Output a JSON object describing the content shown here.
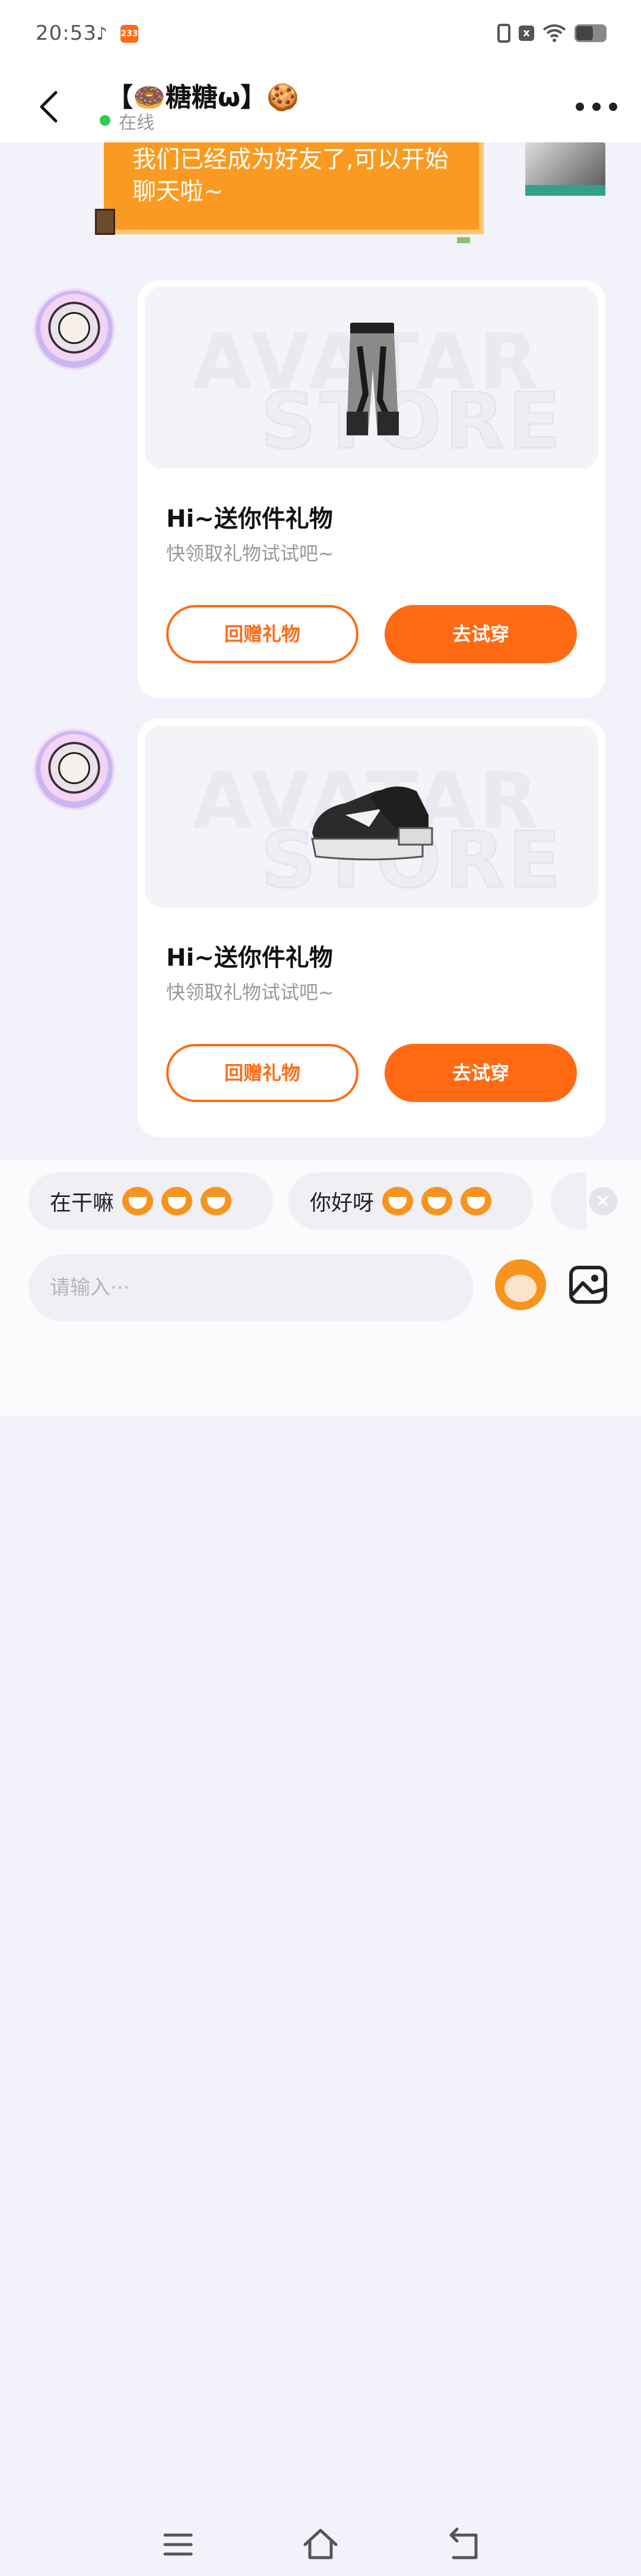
{
  "status_bar": {
    "time": "20:53",
    "badge": "233",
    "sim_icon_label": "x"
  },
  "header": {
    "title": "【🍩糖糖ω】🍪",
    "status": "在线"
  },
  "system_banner": {
    "text": "我们已经成为好友了,可以开始聊天啦~"
  },
  "messages": [
    {
      "watermark_line1": "AVATAR",
      "watermark_line2": "STORE",
      "item_icon": "pants-icon",
      "title": "Hi~送你件礼物",
      "subtitle": "快领取礼物试试吧~",
      "return_gift_label": "回赠礼物",
      "try_on_label": "去试穿"
    },
    {
      "watermark_line1": "AVATAR",
      "watermark_line2": "STORE",
      "item_icon": "sneakers-icon",
      "title": "Hi~送你件礼物",
      "subtitle": "快领取礼物试试吧~",
      "return_gift_label": "回赠礼物",
      "try_on_label": "去试穿"
    }
  ],
  "quick_replies": [
    {
      "text": "在干嘛"
    },
    {
      "text": "你好呀"
    }
  ],
  "composer": {
    "placeholder": "请输入···"
  },
  "colors": {
    "accent": "#ff6a13",
    "banner": "#fb9a20",
    "online": "#2fcc52",
    "background": "#f2f2fa"
  }
}
